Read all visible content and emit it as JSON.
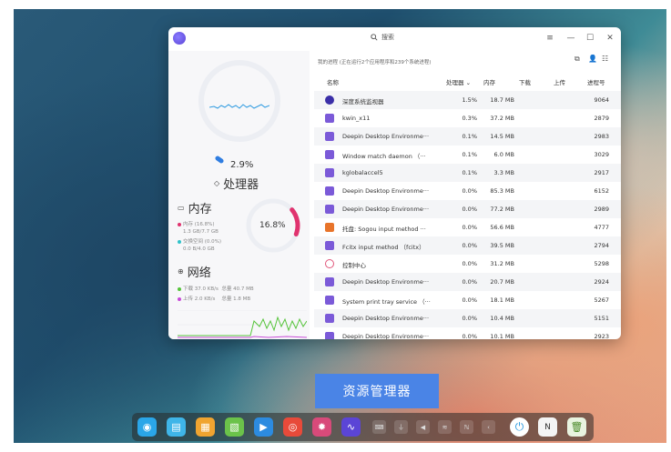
{
  "window": {
    "search_placeholder": "搜索",
    "buttons": {
      "menu": "≡",
      "minimize": "—",
      "maximize": "☐",
      "close": "✕"
    }
  },
  "left_panel": {
    "cpu": {
      "percent": "2.9%",
      "title": "处理器",
      "usage": 0.029
    },
    "memory": {
      "title": "内存",
      "percent": "16.8%",
      "usage": 0.168,
      "mem_line1": "内存 (16.8%)",
      "mem_line2": "1.3 GB/7.7 GB",
      "swap_line1": "交换空间 (0.0%)",
      "swap_line2": "0.0 B/4.0 GB"
    },
    "network": {
      "title": "网络",
      "download": "下载 37.0 KB/s",
      "download_total": "总量 40.7 MB",
      "upload": "上传 2.0 KB/s",
      "upload_total": "总量 1.8 MB"
    }
  },
  "process_list": {
    "summary": "我的进程 (正在运行2个应用程序和239个系统进程)",
    "columns": {
      "name": "名称",
      "cpu": "处理器",
      "memory": "内存",
      "download": "下载",
      "upload": "上传",
      "pid": "进程号"
    },
    "rows": [
      {
        "name": "深度系统监视器",
        "cpu": "1.5%",
        "mem": "18.7 MB",
        "pid": "9064",
        "icon_color": "#3b2fa8"
      },
      {
        "name": "kwin_x11",
        "cpu": "0.3%",
        "mem": "37.2 MB",
        "pid": "2879",
        "icon_color": "#7b5ad8"
      },
      {
        "name": "Deepin Desktop Environme···",
        "cpu": "0.1%",
        "mem": "14.5 MB",
        "pid": "2983",
        "icon_color": "#7b5ad8"
      },
      {
        "name": "Window match daemon （···",
        "cpu": "0.1%",
        "mem": "6.0 MB",
        "pid": "3029",
        "icon_color": "#7b5ad8"
      },
      {
        "name": "kglobalaccel5",
        "cpu": "0.1%",
        "mem": "3.3 MB",
        "pid": "2917",
        "icon_color": "#7b5ad8"
      },
      {
        "name": "Deepin Desktop Environme···",
        "cpu": "0.0%",
        "mem": "85.3 MB",
        "pid": "6152",
        "icon_color": "#7b5ad8"
      },
      {
        "name": "Deepin Desktop Environme···",
        "cpu": "0.0%",
        "mem": "77.2 MB",
        "pid": "2989",
        "icon_color": "#7b5ad8"
      },
      {
        "name": "托盘: Sogou input method ···",
        "cpu": "0.0%",
        "mem": "56.6 MB",
        "pid": "4777",
        "icon_color": "#e8742a"
      },
      {
        "name": "Fcitx input method （fcitx）",
        "cpu": "0.0%",
        "mem": "39.5 MB",
        "pid": "2794",
        "icon_color": "#7b5ad8"
      },
      {
        "name": "控制中心",
        "cpu": "0.0%",
        "mem": "31.2 MB",
        "pid": "5298",
        "icon_color": "#e0557a"
      },
      {
        "name": "Deepin Desktop Environme···",
        "cpu": "0.0%",
        "mem": "20.7 MB",
        "pid": "2924",
        "icon_color": "#7b5ad8"
      },
      {
        "name": "System print tray service （···",
        "cpu": "0.0%",
        "mem": "18.1 MB",
        "pid": "5267",
        "icon_color": "#7b5ad8"
      },
      {
        "name": "Deepin Desktop Environme···",
        "cpu": "0.0%",
        "mem": "10.4 MB",
        "pid": "5151",
        "icon_color": "#7b5ad8"
      },
      {
        "name": "Deepin Desktop Environme···",
        "cpu": "0.0%",
        "mem": "10.1 MB",
        "pid": "2923",
        "icon_color": "#7b5ad8"
      }
    ]
  },
  "caption": "资源管理器",
  "dock": {
    "apps": [
      {
        "name": "launcher-icon",
        "color": "#2aa6e8",
        "glyph": "◉"
      },
      {
        "name": "file-manager-icon",
        "color": "#3fb5e8",
        "glyph": "▤"
      },
      {
        "name": "app-store-icon",
        "color": "#f0a430",
        "glyph": "▦"
      },
      {
        "name": "document-viewer-icon",
        "color": "#6bc24a",
        "glyph": "▧"
      },
      {
        "name": "media-player-icon",
        "color": "#2c8be0",
        "glyph": "▶"
      },
      {
        "name": "chrome-icon",
        "color": "#e84a3a",
        "glyph": "◎"
      },
      {
        "name": "settings-icon",
        "color": "#d84a7a",
        "glyph": "✹"
      },
      {
        "name": "system-monitor-icon",
        "color": "#5b45d6",
        "glyph": "∿"
      }
    ],
    "tray": [
      {
        "name": "keyboard-tray-icon",
        "glyph": "⌨"
      },
      {
        "name": "usb-tray-icon",
        "glyph": "⏚"
      },
      {
        "name": "volume-tray-icon",
        "glyph": "◀"
      },
      {
        "name": "wifi-tray-icon",
        "glyph": "≋"
      },
      {
        "name": "input-method-tray-icon",
        "glyph": "ℕ"
      },
      {
        "name": "expand-tray-icon",
        "glyph": "‹"
      }
    ]
  }
}
